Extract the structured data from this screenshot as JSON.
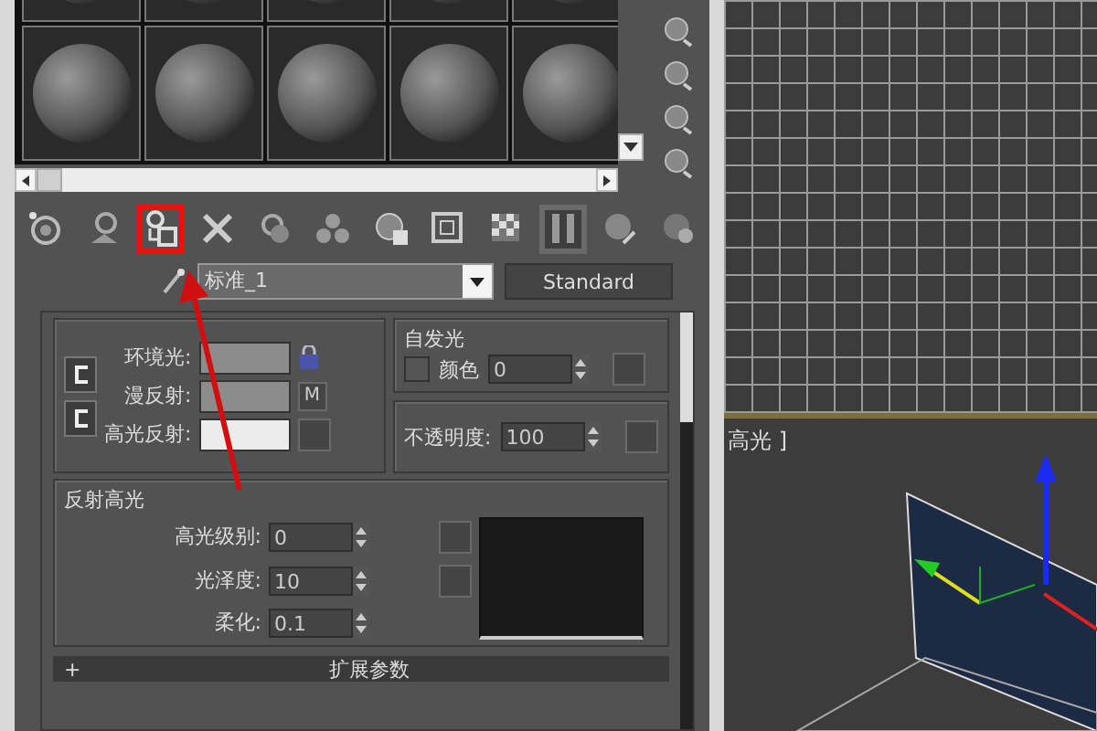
{
  "toolbar": [
    {
      "kind": "get",
      "active": false,
      "highlighted": false
    },
    {
      "kind": "put",
      "active": false,
      "highlighted": false
    },
    {
      "kind": "assign",
      "active": false,
      "highlighted": true
    },
    {
      "kind": "delete",
      "active": false,
      "highlighted": false
    },
    {
      "kind": "copy",
      "active": false,
      "highlighted": false
    },
    {
      "kind": "unique",
      "active": false,
      "highlighted": false
    },
    {
      "kind": "library",
      "active": false,
      "highlighted": false
    },
    {
      "kind": "effects",
      "active": false,
      "highlighted": false
    },
    {
      "kind": "checker",
      "active": false,
      "highlighted": false
    },
    {
      "kind": "bars",
      "active": true,
      "highlighted": false
    },
    {
      "kind": "parent",
      "active": false,
      "highlighted": false
    },
    {
      "kind": "sibling",
      "active": false,
      "highlighted": false
    }
  ],
  "material": {
    "name": "标准_1",
    "type_button": "Standard"
  },
  "basic_params": {
    "swatches": [
      {
        "label": "环境光:",
        "color": "#8c8c8c"
      },
      {
        "label": "漫反射:",
        "color": "#8c8c8c"
      },
      {
        "label": "高光反射:",
        "color": "#ececec"
      }
    ],
    "map_button": "M"
  },
  "self_illumination": {
    "title": "自发光",
    "color_checked": false,
    "color_label": "颜色",
    "value": "0"
  },
  "opacity": {
    "label": "不透明度:",
    "value": "100"
  },
  "specular_highlights": {
    "title": "反射高光",
    "fields": [
      {
        "label": "高光级别:",
        "value": "0",
        "map": true
      },
      {
        "label": "光泽度:",
        "value": "10",
        "map": true
      },
      {
        "label": "柔化:",
        "value": "0.1",
        "map": false
      }
    ]
  },
  "rollout": {
    "sign": "+",
    "title": "扩展参数"
  },
  "viewport": {
    "label": "高光 ]"
  }
}
